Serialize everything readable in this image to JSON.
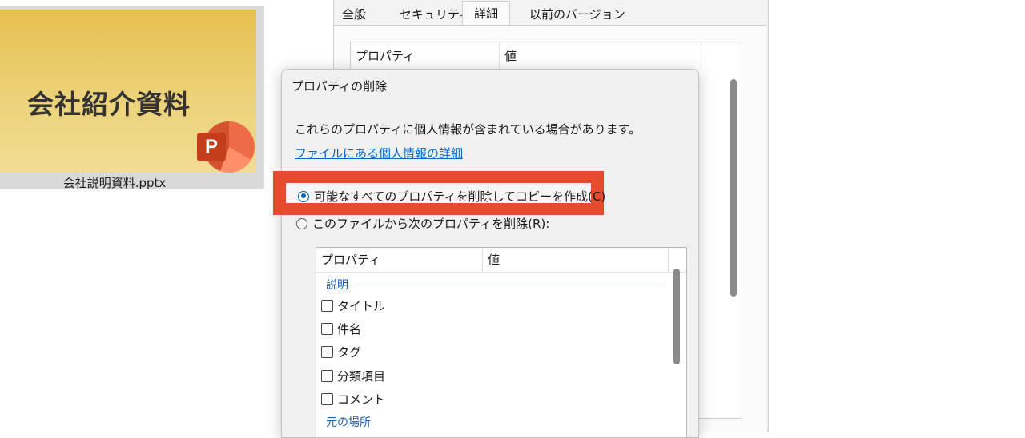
{
  "thumbnail": {
    "slide_title": "会社紹介資料",
    "app_icon_letter": "P",
    "file_name": "会社説明資料.pptx"
  },
  "properties_window": {
    "tabs": [
      "全般",
      "セキュリティ",
      "詳細",
      "以前のバージョン"
    ],
    "active_tab": "詳細",
    "columns": [
      "プロパティ",
      "値"
    ]
  },
  "dialog": {
    "title": "プロパティの削除",
    "message": "これらのプロパティに個人情報が含まれている場合があります。",
    "link": "ファイルにある個人情報の詳細",
    "option_copy": "可能なすべてのプロパティを削除してコピーを作成(C)",
    "option_remove": "このファイルから次のプロパティを削除(R):",
    "selected_option": "option_copy",
    "list": {
      "columns": [
        "プロパティ",
        "値"
      ],
      "group": "説明",
      "items": [
        "タイトル",
        "件名",
        "タグ",
        "分類項目",
        "コメント"
      ],
      "group_2": "元の場所"
    }
  },
  "colors": {
    "highlight": "#e64a2f",
    "link": "#0066cc",
    "group_label": "#1e5fb0",
    "slide_bg": "#e6c04c"
  }
}
